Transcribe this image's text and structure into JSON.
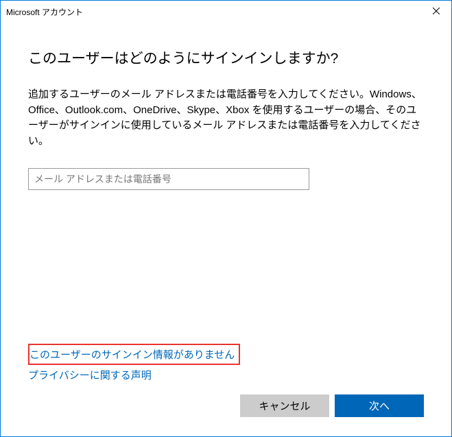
{
  "titlebar": {
    "title": "Microsoft アカウント"
  },
  "main": {
    "heading": "このユーザーはどのようにサインインしますか?",
    "description": "追加するユーザーのメール アドレスまたは電話番号を入力してください。Windows、Office、Outlook.com、OneDrive、Skype、Xbox を使用するユーザーの場合、そのユーザーがサインインに使用しているメール アドレスまたは電話番号を入力してください。",
    "input_placeholder": "メール アドレスまたは電話番号",
    "input_value": ""
  },
  "links": {
    "no_signin_info": "このユーザーのサインイン情報がありません",
    "privacy": "プライバシーに関する声明"
  },
  "buttons": {
    "cancel": "キャンセル",
    "next": "次へ"
  }
}
